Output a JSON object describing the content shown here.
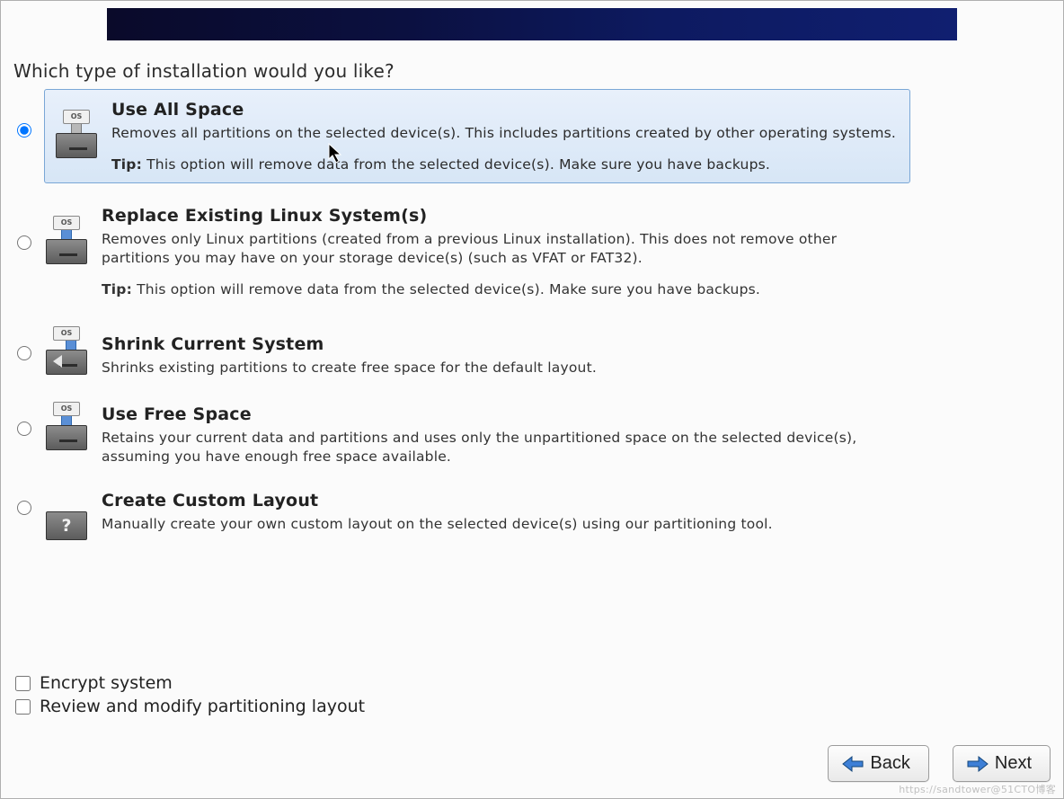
{
  "heading": "Which type of installation would you like?",
  "os_tab": "OS",
  "tip_label": "Tip:",
  "options": [
    {
      "id": "use-all-space",
      "title": "Use All Space",
      "desc": "Removes all partitions on the selected device(s).  This includes partitions created by other operating systems.",
      "tip": "This option will remove data from the selected device(s).  Make sure you have backups.",
      "selected": true
    },
    {
      "id": "replace-existing",
      "title": "Replace Existing Linux System(s)",
      "desc": "Removes only Linux partitions (created from a previous Linux installation).  This does not remove other partitions you may have on your storage device(s) (such as VFAT or FAT32).",
      "tip": "This option will remove data from the selected device(s).  Make sure you have backups.",
      "selected": false
    },
    {
      "id": "shrink-current",
      "title": "Shrink Current System",
      "desc": "Shrinks existing partitions to create free space for the default layout.",
      "tip": "",
      "selected": false
    },
    {
      "id": "use-free-space",
      "title": "Use Free Space",
      "desc": "Retains your current data and partitions and uses only the unpartitioned space on the selected device(s), assuming you have enough free space available.",
      "tip": "",
      "selected": false
    },
    {
      "id": "custom-layout",
      "title": "Create Custom Layout",
      "desc": "Manually create your own custom layout on the selected device(s) using our partitioning tool.",
      "tip": "",
      "selected": false
    }
  ],
  "checkboxes": {
    "encrypt": {
      "label": "Encrypt system",
      "checked": false
    },
    "review": {
      "label": "Review and modify partitioning layout",
      "checked": false
    }
  },
  "buttons": {
    "back": "Back",
    "next": "Next"
  },
  "watermark": "https://sandtower@51CTO博客",
  "question_mark": "?"
}
